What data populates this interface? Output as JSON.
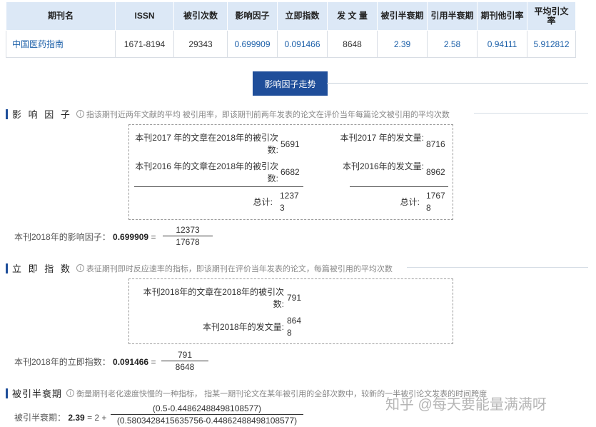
{
  "table": {
    "headers": [
      "期刊名",
      "ISSN",
      "被引次数",
      "影响因子",
      "立即指数",
      "发 文 量",
      "被引半衰期",
      "引用半衰期",
      "期刊他引率",
      "平均引文率"
    ],
    "row": [
      "中国医药指南",
      "1671-8194",
      "29343",
      "0.699909",
      "0.091466",
      "8648",
      "2.39",
      "2.58",
      "0.94111",
      "5.912812"
    ]
  },
  "trend_button": "影响因子走势",
  "impact": {
    "title": "影 响 因 子",
    "info_icon": "i",
    "desc": "指该期刊近两年文献的平均 被引用率，即该期刊前两年发表的论文在评价当年每篇论文被引用的平均次数",
    "left_label_1": "本刊2017 年的文章在2018年的被引次数:",
    "left_val_1": "5691",
    "left_label_2": "本刊2016 年的文章在2018年的被引次数:",
    "left_val_2": "6682",
    "left_total_label": "总计:",
    "left_total": "12373",
    "right_label_1": "本刊2017 年的发文量:",
    "right_val_1": "8716",
    "right_label_2": "本刊2016年的发文量:",
    "right_val_2": "8962",
    "right_total_label": "总计:",
    "right_total": "17678",
    "formula_label": "本刊2018年的影响因子：",
    "formula_value": "0.699909",
    "formula_eq": "=",
    "numerator": "12373",
    "denominator": "17678"
  },
  "immediacy": {
    "title": "立 即 指 数",
    "info_icon": "i",
    "desc": "表征期刊即时反应速率的指标，即该期刊在评价当年发表的论文，每篇被引用的平均次数",
    "label_1": "本刊2018年的文章在2018年的被引次数:",
    "val_1": "791",
    "label_2": "本刊2018年的发文量:",
    "val_2": "8648",
    "formula_label": "本刊2018年的立即指数：",
    "formula_value": "0.091466",
    "formula_eq": "=",
    "numerator": "791",
    "denominator": "8648"
  },
  "halflife": {
    "title": "被引半衰期",
    "info_icon": "i",
    "desc": "衡量期刊老化速度快慢的一种指标， 指某一期刊论文在某年被引用的全部次数中，较新的一半被引论文发表的时间跨度",
    "formula_label": "被引半衰期：",
    "formula_value": "2.39",
    "formula_mid": "= 2 +",
    "numerator": "(0.5-0.44862488498108577)",
    "denominator": "(0.5803428415635756-0.44862488498108577)"
  },
  "watermark": "知乎 @每天要能量满满呀"
}
